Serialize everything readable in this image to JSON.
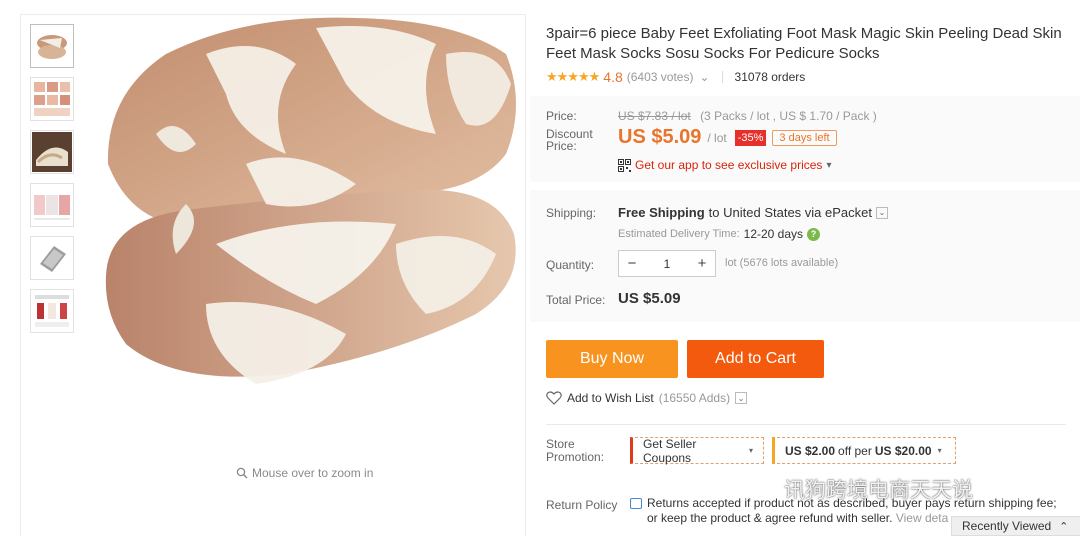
{
  "gallery": {
    "zoom_hint": "Mouse over to zoom in",
    "thumbnails": [
      "thumb-1",
      "thumb-2",
      "thumb-3",
      "thumb-4",
      "thumb-5",
      "thumb-6"
    ]
  },
  "product": {
    "title": "3pair=6 piece Baby Feet Exfoliating Foot Mask Magic Skin Peeling Dead Skin Feet Mask Socks Sosu Socks For Pedicure Socks",
    "stars": "★★★★★",
    "rating": "4.8",
    "votes": "(6403 votes)",
    "votes_caret": "⌄",
    "orders": "31078 orders"
  },
  "price": {
    "label": "Price:",
    "original": "US $7.83 / lot",
    "original_note": "(3 Packs / lot , US $ 1.70 / Pack )",
    "discount_label": "Discount Price:",
    "discount_amount": "US $5.09",
    "unit": "/ lot",
    "percent_off": "-35%",
    "days_left": "3 days left",
    "app_promo": "Get our app to see exclusive prices",
    "app_caret": "▾"
  },
  "shipping": {
    "label": "Shipping:",
    "free_text": "Free Shipping",
    "to_text": "to United States via ePacket",
    "caret": "⌄",
    "est_label": "Estimated Delivery Time:",
    "est_days": "12-20 days",
    "help": "?"
  },
  "quantity": {
    "label": "Quantity:",
    "minus": "−",
    "value": "1",
    "plus": "+",
    "available": "lot (5676 lots available)"
  },
  "total": {
    "label": "Total Price:",
    "value": "US $5.09"
  },
  "actions": {
    "buy_now": "Buy Now",
    "add_to_cart": "Add to Cart",
    "wish_label": "Add to Wish List",
    "wish_count": "(16550 Adds)",
    "wish_caret": "⌄"
  },
  "store": {
    "label": "Store Promotion:",
    "coupon_label": "Get Seller Coupons",
    "coupon_caret": "▾",
    "deal_amount": "US $2.00",
    "deal_mid": "off per",
    "deal_threshold": "US $20.00",
    "deal_caret": "▾"
  },
  "returns": {
    "label": "Return Policy",
    "text": "Returns accepted if product not as described, buyer pays return shipping fee; or keep the product & agree refund with seller.",
    "more": "View deta"
  },
  "overlay": {
    "watermark": "讯狗跨境电商天天说",
    "recently_viewed": "Recently Viewed",
    "recent_caret": "⌃"
  },
  "colors": {
    "accent_orange": "#e8752a",
    "buy_now": "#f7931e",
    "add_to_cart": "#f35a0d",
    "discount_red": "#e5302b"
  }
}
